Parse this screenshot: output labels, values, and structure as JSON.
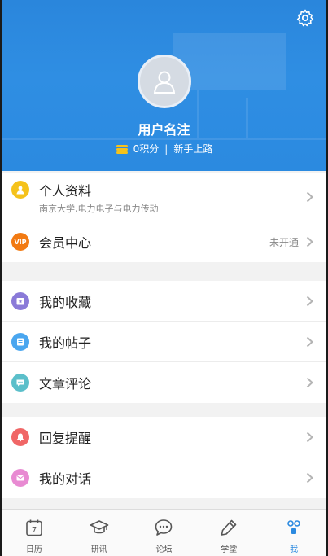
{
  "profile": {
    "username": "用户名注",
    "points": "0积分",
    "separator": "|",
    "level": "新手上路"
  },
  "menu": {
    "group1": [
      {
        "label": "个人资料",
        "desc": "南京大学,电力电子与电力传动",
        "icon": "user-icon",
        "color": "#f5c21b"
      },
      {
        "label": "会员中心",
        "right": "未开通",
        "icon": "vip-icon",
        "icon_text": "VIP",
        "color": "#f27a12"
      }
    ],
    "group2": [
      {
        "label": "我的收藏",
        "icon": "star-folder-icon",
        "color": "#8a7ad8"
      },
      {
        "label": "我的帖子",
        "icon": "document-icon",
        "color": "#4aa6ef"
      },
      {
        "label": "文章评论",
        "icon": "comment-icon",
        "color": "#5bbfca"
      }
    ],
    "group3": [
      {
        "label": "回复提醒",
        "icon": "bell-icon",
        "color": "#f06666"
      },
      {
        "label": "我的对话",
        "icon": "mail-icon",
        "color": "#e88ad2"
      }
    ]
  },
  "tabbar": {
    "items": [
      {
        "label": "日历",
        "icon": "calendar-icon",
        "badge": "7"
      },
      {
        "label": "研讯",
        "icon": "graduation-cap-icon"
      },
      {
        "label": "论坛",
        "icon": "chat-bubble-icon"
      },
      {
        "label": "学堂",
        "icon": "pencil-icon"
      },
      {
        "label": "我",
        "icon": "profile-icon"
      }
    ],
    "active": "我"
  },
  "colors": {
    "header_blue": "#2b8ae0",
    "active_tab": "#2b8ae0"
  }
}
